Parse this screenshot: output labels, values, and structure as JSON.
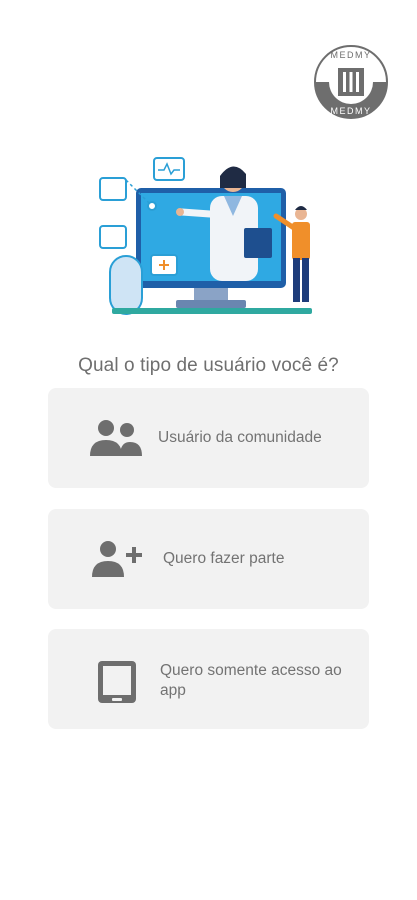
{
  "logo": {
    "text_top": "MEDMY",
    "text_bottom": "MEDMY"
  },
  "illustration": {
    "name": "telemedicine-illustration"
  },
  "question": "Qual o tipo de usuário você é?",
  "options": [
    {
      "label": "Usuário da comunidade",
      "icon": "group-users-icon"
    },
    {
      "label": "Quero fazer parte",
      "icon": "add-user-icon"
    },
    {
      "label": "Quero somente acesso ao app",
      "icon": "tablet-icon"
    }
  ],
  "colors": {
    "option_bg": "#f2f2f2",
    "icon_gray": "#6e6e6e",
    "text_gray": "#737373",
    "accent_blue": "#2a9fd6"
  }
}
